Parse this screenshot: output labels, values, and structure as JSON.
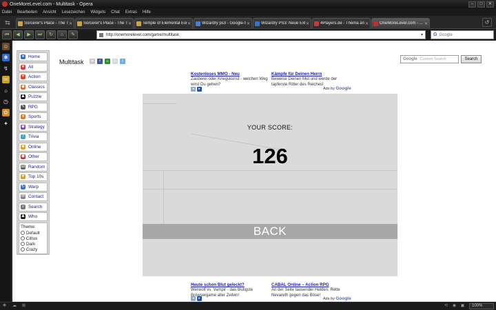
{
  "window": {
    "title": "OneMoreLevel.com - Multitask - Opera",
    "minimize_glyph": "–",
    "maximize_glyph": "□",
    "close_glyph": "✕"
  },
  "menu": [
    "Datei",
    "Bearbeiten",
    "Ansicht",
    "Lesezeichen",
    "Widgets",
    "Chat",
    "Extras",
    "Hilfe"
  ],
  "tabs": [
    {
      "label": "Sorcerer's Place - The Te...",
      "favicon_color": "#c9a34a"
    },
    {
      "label": "Sorcerer's Place - The Te...",
      "favicon_color": "#c9a34a"
    },
    {
      "label": "Temple of Elemental Evil ...",
      "favicon_color": "#c9a34a"
    },
    {
      "label": "Wizardry ps3 - Google-Su...",
      "favicon_color": "#4a7bd6"
    },
    {
      "label": "Wizardry PS3: Neue Exklu...",
      "favicon_color": "#3a6fd1"
    },
    {
      "label": "4Players.de - Thema anz...",
      "favicon_color": "#c43a3a"
    },
    {
      "label": "OneMoreLevel.com - ...",
      "favicon_color": "#c0302a"
    }
  ],
  "tab_close_glyph": "✕",
  "tab_scroll_icon": "⇆",
  "trash_icon": "↺",
  "nav": {
    "buttons": [
      "⏮",
      "◀",
      "▶",
      "⏭",
      "↻",
      "⌂",
      "✎"
    ],
    "url": "http://onemorelevel.com/game/multitask",
    "url_drop": "▾",
    "search_engine_glyph": "G",
    "search_placeholder": "Google"
  },
  "left_panel_icons": [
    "☺",
    "✱",
    "↯",
    "✉",
    "☼",
    "◷",
    "✿",
    "✦",
    "⁂"
  ],
  "page": {
    "title": "Multitask",
    "header_icons": [
      {
        "glyph": "✉",
        "color": "#c8c8c8"
      },
      {
        "glyph": "f",
        "color": "#3b5998"
      },
      {
        "glyph": "☺",
        "color": "#2c8a3a"
      },
      {
        "glyph": "G",
        "color": "#d8d8d8"
      },
      {
        "glyph": "t",
        "color": "#6ab0e6"
      }
    ],
    "search_logo": "Google",
    "search_placeholder": "Custom Search",
    "search_button": "Search"
  },
  "sidebar": {
    "items": [
      {
        "label": "Home",
        "icon": "●",
        "color": "#3a6fd1"
      },
      {
        "label": "All",
        "icon": "★",
        "color": "#d23b3b"
      },
      {
        "label": "Action",
        "icon": "✦",
        "color": "#d94a2c"
      },
      {
        "label": "Classics",
        "icon": "◆",
        "color": "#e06a1f"
      },
      {
        "label": "Puzzle",
        "icon": "♟",
        "color": "#222222"
      },
      {
        "label": "RPG",
        "icon": "✎",
        "color": "#555555"
      },
      {
        "label": "Sports",
        "icon": "●",
        "color": "#e07b20"
      },
      {
        "label": "Strategy",
        "icon": "◉",
        "color": "#7a3fb0"
      },
      {
        "label": "Trivia",
        "icon": "?",
        "color": "#3aa6c9"
      },
      {
        "label": "Online",
        "icon": "☻",
        "color": "#e0a020"
      },
      {
        "label": "Other",
        "icon": "◼",
        "color": "#c03030"
      },
      {
        "label": "Random",
        "icon": "⚄",
        "color": "#666666"
      },
      {
        "label": "Top 10s",
        "icon": "★",
        "color": "#e0a020"
      },
      {
        "label": "Warp",
        "icon": "↻",
        "color": "#3a6fd1"
      },
      {
        "label": "Contact",
        "icon": "✉",
        "color": "#888888"
      },
      {
        "label": "Search",
        "icon": "⌕",
        "color": "#777777"
      },
      {
        "label": "Who",
        "icon": "♟",
        "color": "#222222"
      }
    ],
    "theme": {
      "title": "Theme:",
      "options": [
        "Default",
        "Citrus",
        "Dark",
        "Crazy"
      ]
    }
  },
  "ads_top": [
    {
      "title": "Kostenloses MMO - Neu",
      "text": "Zauberei oder Kriegskunst - welchen Weg wirst Du gehen?"
    },
    {
      "title": "Kämpfe für Deinen Herrn",
      "text": "Beweise Deinen Mut und werde der tapferste Ritter des Reiches!"
    }
  ],
  "ads_bottom": [
    {
      "title": "Heute schon Blut geleckt?",
      "text": "Werwolf vs. Vampir - das blutigste Browsergame aller Zeiten!"
    },
    {
      "title": "CABAL Online – Action RPG",
      "text": "An der Seite tausender Helden. Rette Nevareth gegen das Böse!"
    }
  ],
  "ad_nav": [
    "◂",
    "▸"
  ],
  "ads_by": {
    "prefix": "Ads by ",
    "brand": "Google"
  },
  "game": {
    "score_label": "YOUR SCORE:",
    "score_value": "126",
    "back_label": "BACK"
  },
  "status": {
    "left_icons": [
      "✥",
      "☁",
      "⊞"
    ],
    "right_icons": [
      "⟲",
      "◉",
      "▣"
    ],
    "zoom": "100%"
  }
}
